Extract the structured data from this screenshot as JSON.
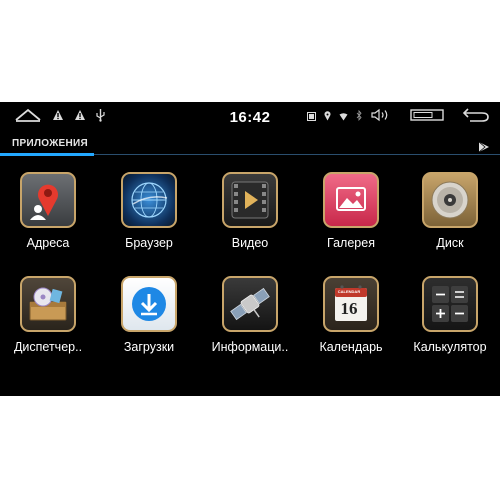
{
  "status": {
    "time": "16:42"
  },
  "tab": {
    "label": "ПРИЛОЖЕНИЯ"
  },
  "apps": [
    {
      "label": "Адреса",
      "icon": "maps-pin-icon"
    },
    {
      "label": "Браузер",
      "icon": "globe-icon"
    },
    {
      "label": "Видео",
      "icon": "video-play-icon"
    },
    {
      "label": "Галерея",
      "icon": "gallery-icon"
    },
    {
      "label": "Диск",
      "icon": "disc-icon"
    },
    {
      "label": "Диспетчер..",
      "icon": "file-manager-icon"
    },
    {
      "label": "Загрузки",
      "icon": "download-icon"
    },
    {
      "label": "Информаци..",
      "icon": "satellite-icon"
    },
    {
      "label": "Календарь",
      "icon": "calendar-icon"
    },
    {
      "label": "Калькулятор",
      "icon": "calculator-icon"
    }
  ],
  "calendar": {
    "month": "CALENDAR",
    "day": "16"
  },
  "colors": {
    "accent": "#23a8ff",
    "icon_border": "#c8a56a"
  }
}
